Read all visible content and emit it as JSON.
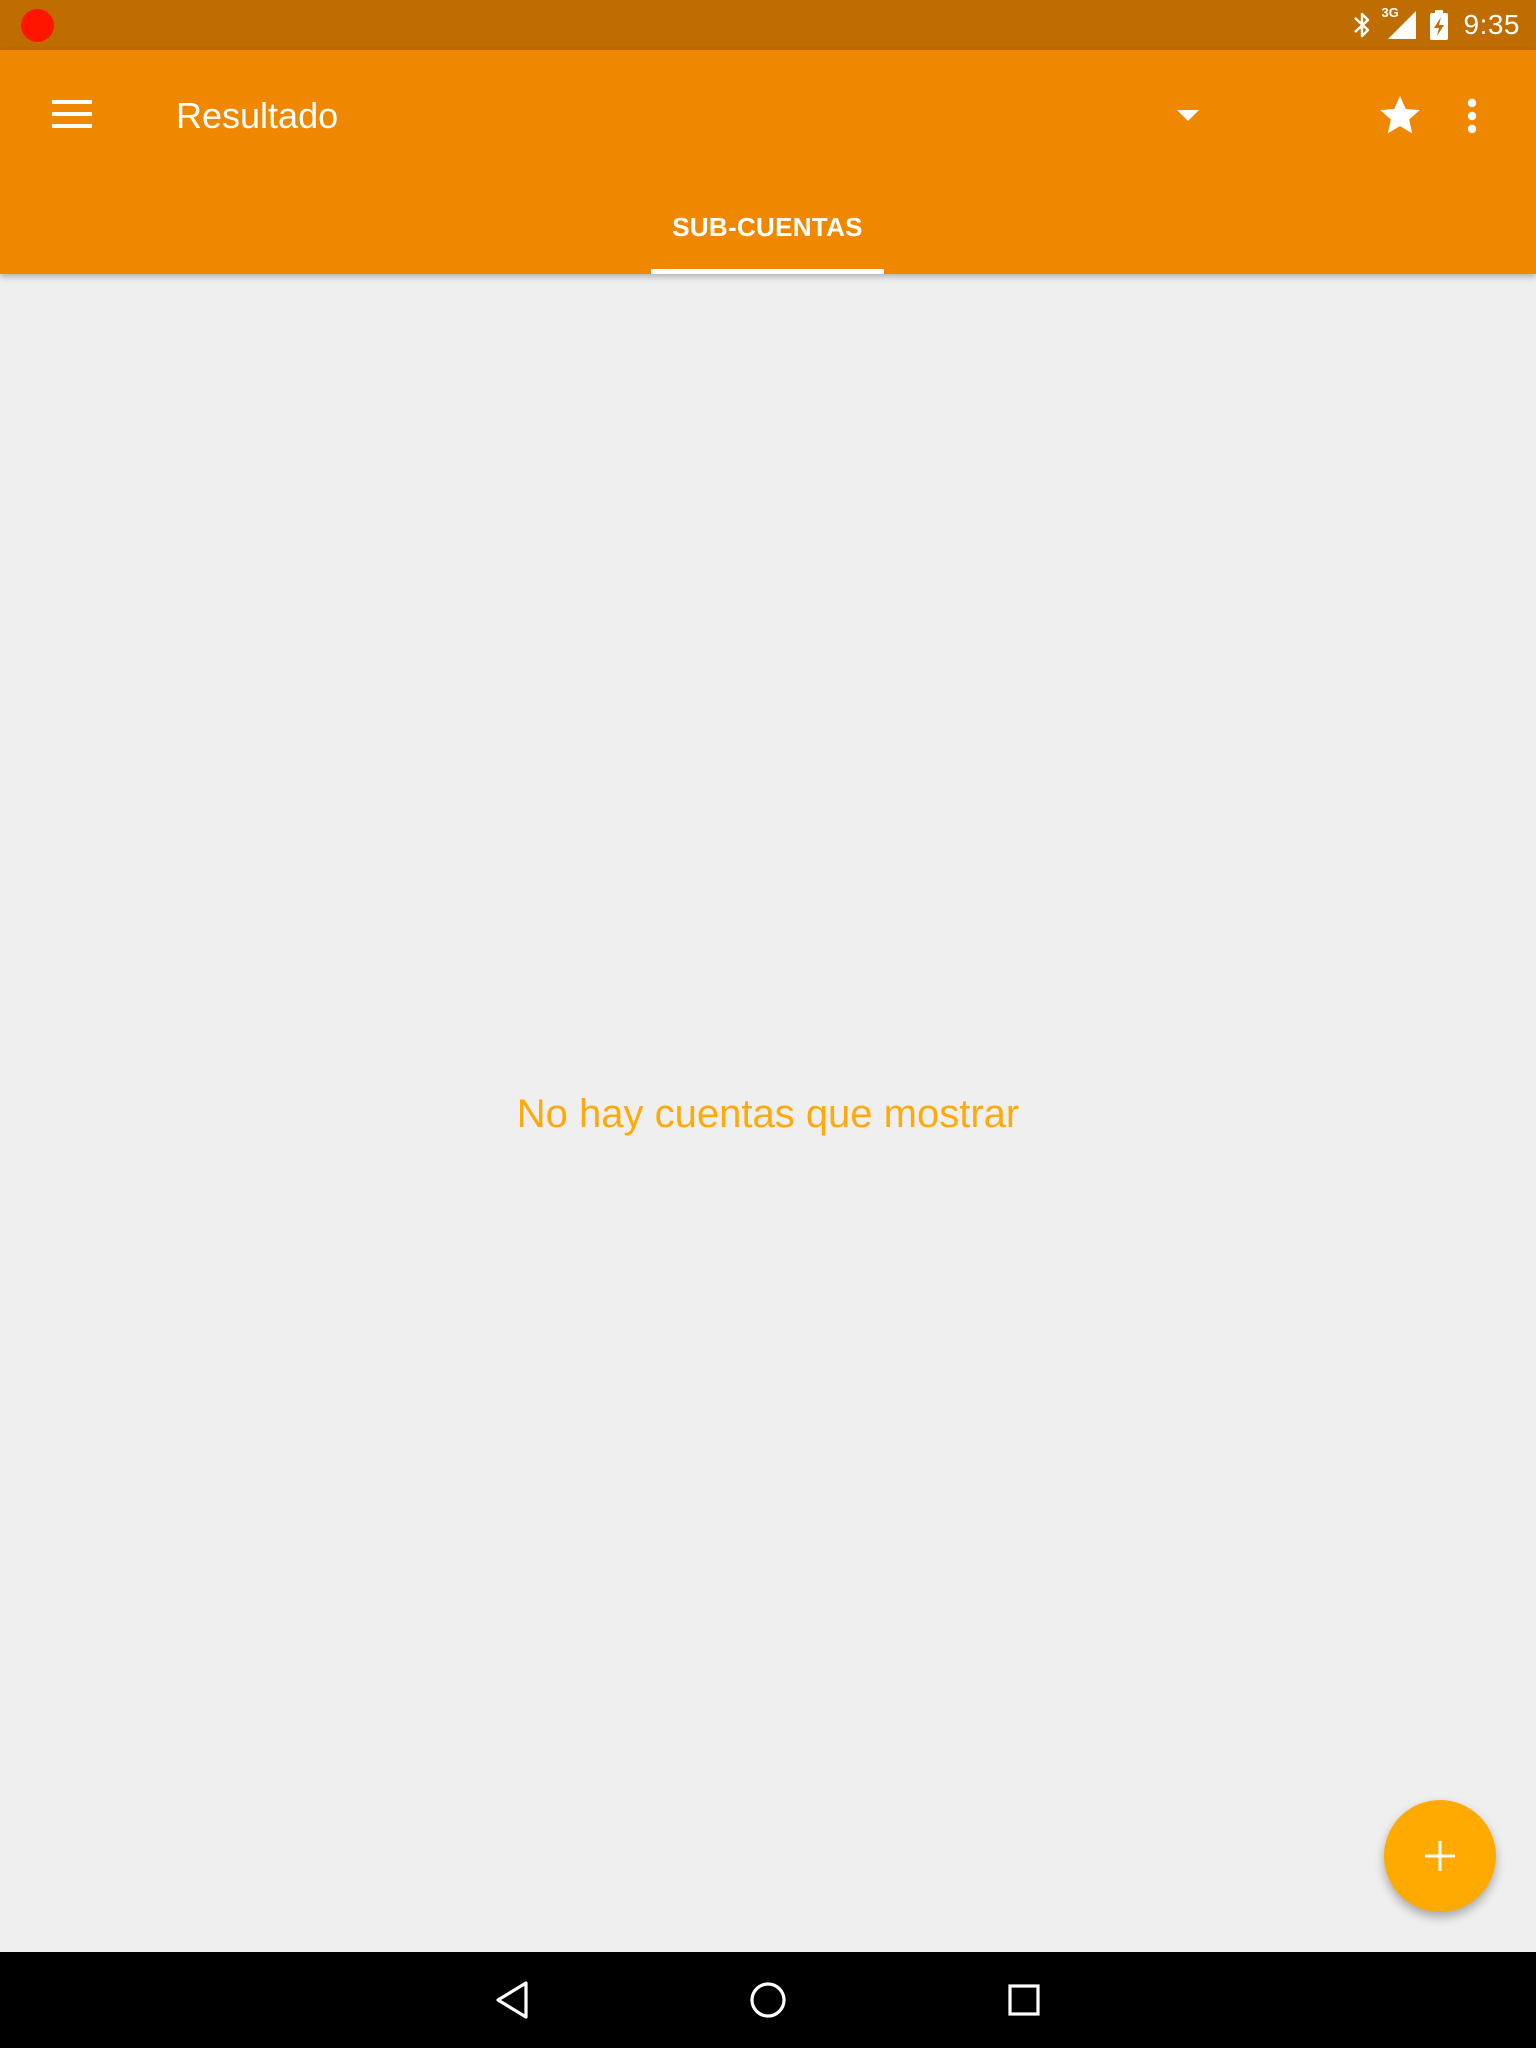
{
  "status_bar": {
    "time": "9:35",
    "network_label": "3G",
    "icons": [
      "recording-dot-icon",
      "bluetooth-icon",
      "cell-signal-icon",
      "battery-charging-icon"
    ],
    "recording_color": "#ff1500"
  },
  "app_bar": {
    "title": "Resultado",
    "background_color": "#ef8800",
    "icons": [
      "menu-icon",
      "dropdown-arrow-icon",
      "star-icon",
      "more-vert-icon"
    ]
  },
  "tabs": [
    {
      "label": "SUB-CUENTAS",
      "selected": true
    }
  ],
  "main": {
    "empty_message": "No hay cuentas que mostrar",
    "empty_message_color": "#ffaa0a"
  },
  "fab": {
    "icon": "add-icon",
    "color": "#ffaa00"
  },
  "nav_bar": {
    "icons": [
      "back-icon",
      "home-icon",
      "recents-icon"
    ]
  }
}
